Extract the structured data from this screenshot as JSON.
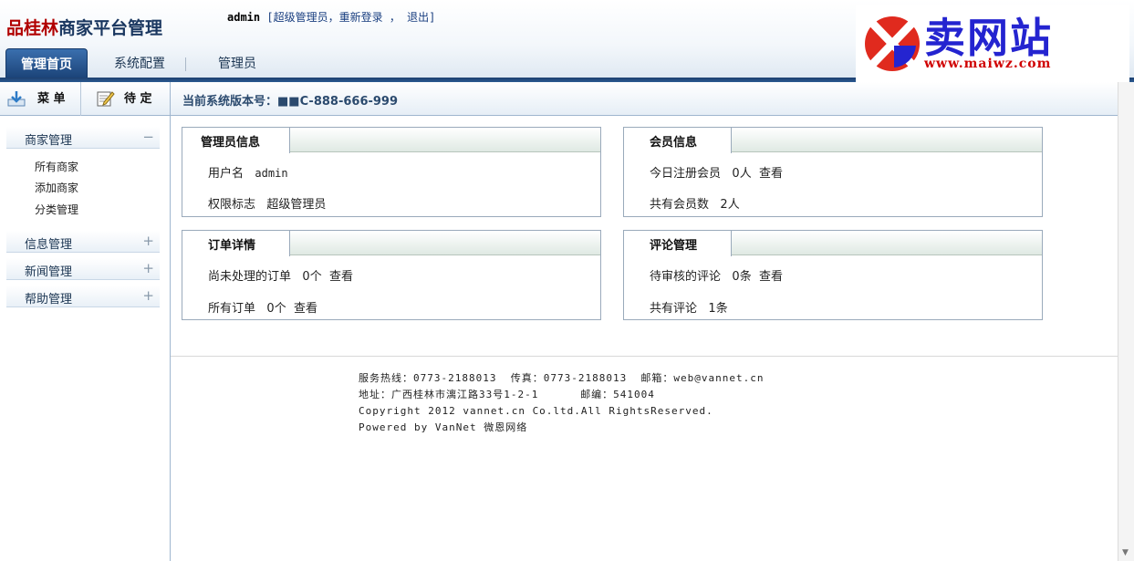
{
  "header": {
    "logo_part1": "品桂林",
    "logo_part2": "商家平台管理",
    "user": {
      "username": "admin",
      "open_bracket": "[",
      "role_link": "超级管理员",
      "comma1": "，",
      "relogin": "重新登录",
      "comma2": " ，",
      "logout": "退出",
      "close_bracket": "]"
    },
    "tabs": [
      {
        "label": "管理首页",
        "active": true
      },
      {
        "label": "系统配置",
        "active": false
      },
      {
        "label": "管理员",
        "active": false
      }
    ],
    "brand": {
      "cn": "卖网站",
      "en": "www.maiwz.com",
      "colors": {
        "circle": "#e02a1e",
        "blue": "#2424d0"
      }
    }
  },
  "sidebar": {
    "menu_button": "菜 单",
    "pending_button": "待 定",
    "groups": [
      {
        "label": "商家管理",
        "toggle": "−",
        "expanded": true,
        "items": [
          "所有商家",
          "添加商家",
          "分类管理"
        ]
      },
      {
        "label": "信息管理",
        "toggle": "+",
        "expanded": false
      },
      {
        "label": "新闻管理",
        "toggle": "+",
        "expanded": false
      },
      {
        "label": "帮助管理",
        "toggle": "+",
        "expanded": false
      }
    ]
  },
  "main": {
    "version_label": "当前系统版本号：",
    "version_value": "■■C-888-666-999",
    "panels": {
      "admin_info": {
        "title": "管理员信息",
        "username_label": "用户名",
        "username_value": "admin",
        "role_label": "权限标志",
        "role_value": "超级管理员"
      },
      "member_info": {
        "title": "会员信息",
        "today_label": "今日注册会员",
        "today_value": "0人",
        "today_link": "查看",
        "total_label": "共有会员数",
        "total_value": "2人"
      },
      "orders": {
        "title": "订单详情",
        "pending_label": "尚未处理的订单",
        "pending_value": "0个",
        "pending_link": "查看",
        "all_label": "所有订单",
        "all_value": "0个",
        "all_link": "查看"
      },
      "comments": {
        "title": "评论管理",
        "pending_label": "待审核的评论",
        "pending_value": "0条",
        "pending_link": "查看",
        "total_label": "共有评论",
        "total_value": "1条"
      }
    },
    "footer": {
      "line1": "服务热线：0773-2188013  传真：0773-2188013  邮箱：web@vannet.cn",
      "line2": "地址：广西桂林市漓江路33号1-2-1      邮编：541004",
      "line3": "Copyright 2012 vannet.cn Co.ltd.All RightsReserved.",
      "line4": "Powered by VanNet 微恩网络"
    }
  }
}
